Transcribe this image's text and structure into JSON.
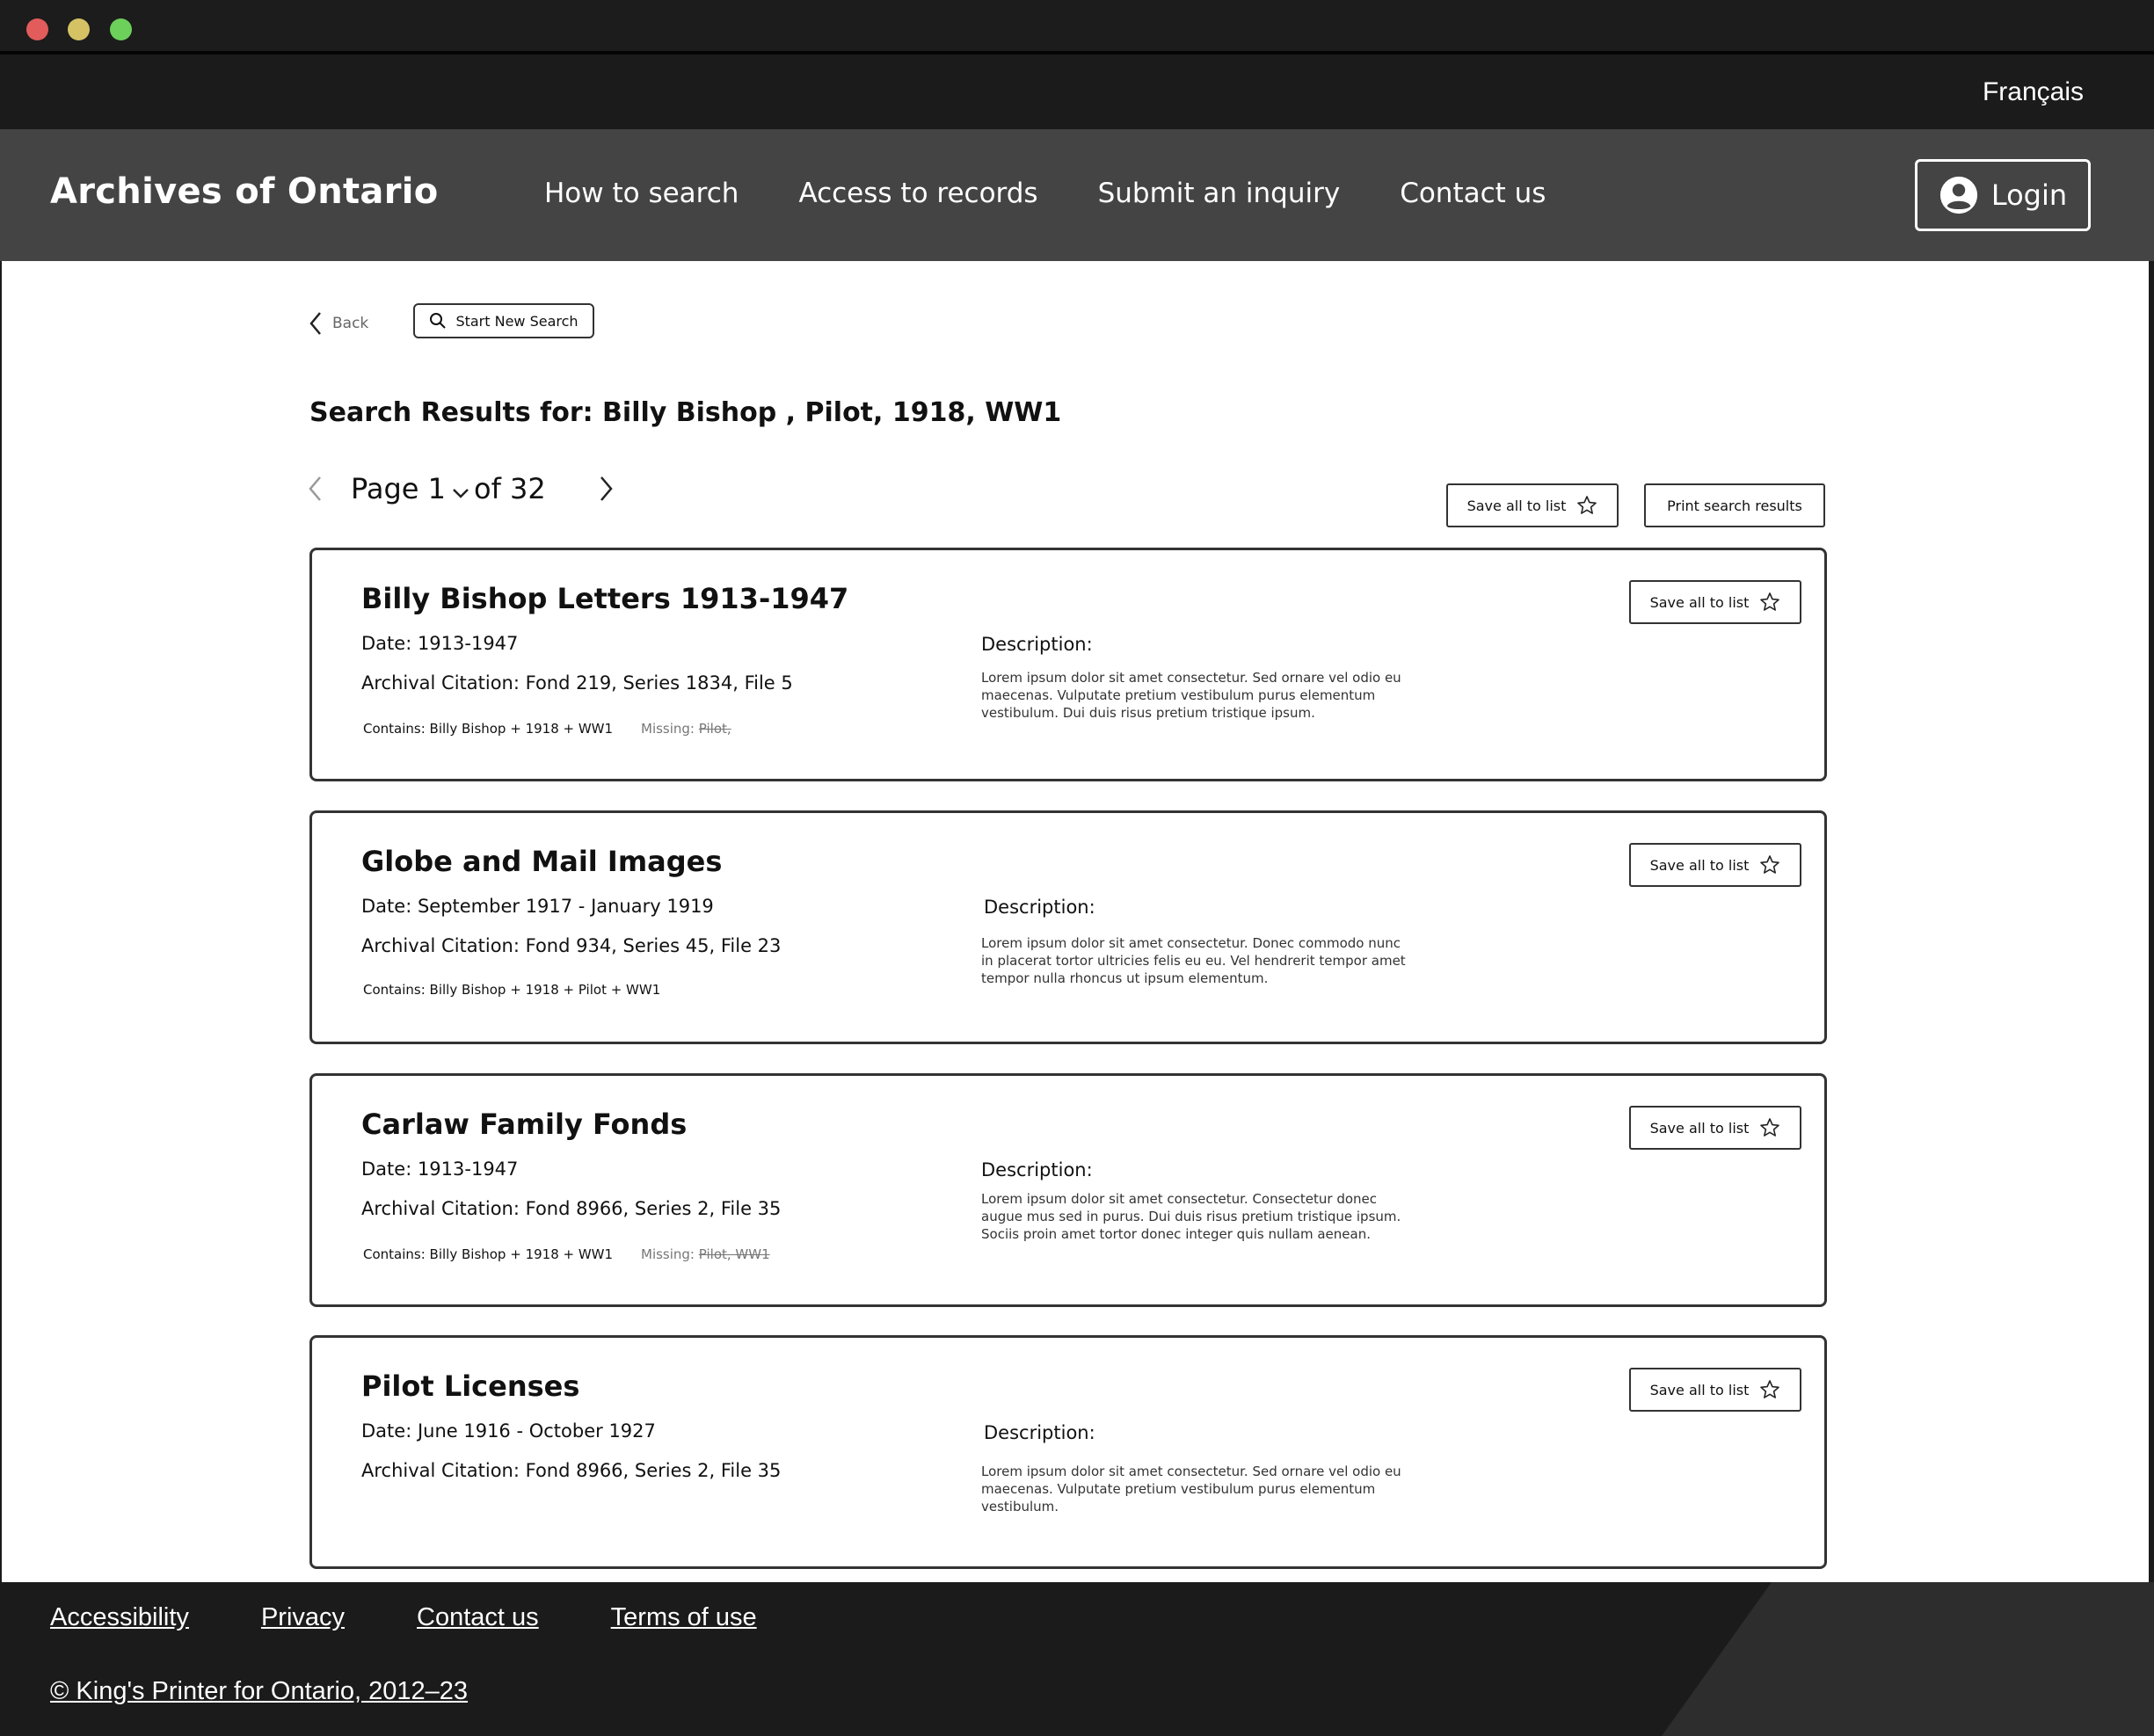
{
  "language_toggle": "Français",
  "header": {
    "brand": "Archives of Ontario",
    "nav": [
      "How to search",
      "Access to records",
      "Submit an inquiry",
      "Contact us"
    ],
    "login_label": "Login"
  },
  "toolbar": {
    "back_label": "Back",
    "new_search_label": "Start New Search"
  },
  "results": {
    "title": "Search Results for: Billy Bishop , Pilot, 1918, WW1",
    "page_label": "Page 1",
    "page_of": "of 32",
    "save_all_label": "Save all to list",
    "print_label": "Print search results"
  },
  "cards": [
    {
      "title": "Billy Bishop Letters 1913-1947",
      "date": "Date: 1913-1947",
      "citation": "Archival Citation: Fond 219, Series 1834, File 5",
      "contains": "Contains: Billy Bishop + 1918 + WW1",
      "missing_label": "Missing:",
      "missing_terms": "Pilot,",
      "desc_label": "Description:",
      "description": "Lorem ipsum dolor sit amet consectetur. Sed ornare vel odio eu maecenas. Vulputate pretium vestibulum purus elementum vestibulum. Dui duis risus pretium tristique ipsum.",
      "save_label": "Save all to list"
    },
    {
      "title": "Globe and Mail Images",
      "date": "Date: September 1917 - January 1919",
      "citation": "Archival Citation: Fond 934, Series 45, File 23",
      "contains": "Contains: Billy Bishop + 1918 + Pilot + WW1",
      "desc_label": "Description:",
      "description": "Lorem ipsum dolor sit amet consectetur. Donec commodo nunc in placerat tortor ultricies felis eu eu. Vel hendrerit tempor amet tempor nulla rhoncus ut ipsum elementum.",
      "save_label": "Save all to list"
    },
    {
      "title": "Carlaw Family Fonds",
      "date": "Date: 1913-1947",
      "citation": "Archival Citation: Fond 8966, Series 2, File 35",
      "contains": "Contains: Billy Bishop + 1918 + WW1",
      "missing_label": "Missing:",
      "missing_terms": "Pilot, WW1",
      "desc_label": "Description:",
      "description": "Lorem ipsum dolor sit amet consectetur. Consectetur donec augue mus sed in purus. Dui duis risus pretium tristique ipsum. Sociis proin amet tortor donec integer quis nullam aenean.",
      "save_label": "Save all to list"
    },
    {
      "title": "Pilot Licenses",
      "date": "Date: June 1916 - October 1927",
      "citation": "Archival Citation: Fond 8966, Series 2, File 35",
      "desc_label": "Description:",
      "description": "Lorem ipsum dolor sit amet consectetur. Sed ornare vel odio eu maecenas. Vulputate pretium vestibulum purus elementum vestibulum.",
      "save_label": "Save all to list"
    }
  ],
  "footer": {
    "links": [
      "Accessibility",
      "Privacy",
      "Contact us",
      "Terms of use"
    ],
    "copyright": "© King's Printer for Ontario, 2012–23"
  },
  "icons": {
    "window_controls": [
      "close-dot",
      "minimize-dot",
      "zoom-dot"
    ],
    "login": "user-circle-icon",
    "back": "chevron-left-icon",
    "search": "search-icon",
    "save": "star-icon"
  },
  "colors": {
    "header_bg": "#444444",
    "topbar_bg": "#1b1b1b",
    "page_bg": "#ffffff",
    "footer_bg": "#1b1b1b"
  }
}
